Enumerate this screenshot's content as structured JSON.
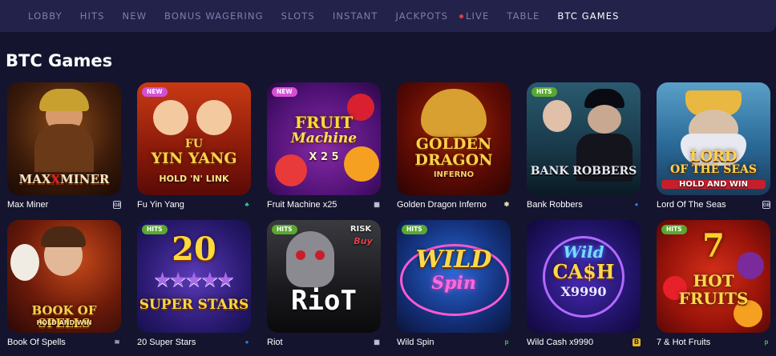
{
  "nav": {
    "items": [
      "LOBBY",
      "HITS",
      "NEW",
      "BONUS WAGERING",
      "SLOTS",
      "INSTANT",
      "JACKPOTS",
      "LIVE",
      "TABLE",
      "BTC GAMES"
    ],
    "active": "BTC GAMES"
  },
  "page_title": "BTC Games",
  "colors": {
    "background": "#14142f",
    "navbar": "#22224a",
    "nav_text": "#7d7eb0",
    "badge_new": "#d44fd6",
    "badge_hits": "#5aa832"
  },
  "games": [
    {
      "name": "Max Miner",
      "badge": "",
      "art_line1": "MAX",
      "art_x": "X",
      "art_line2": "MINER",
      "provider_icon": "GB"
    },
    {
      "name": "Fu Yin Yang",
      "badge": "NEW",
      "art_line1": "FU",
      "art_x": "YIN YANG",
      "art_line2": "HOLD 'N' LINK",
      "provider_icon": "green-leaf-icon"
    },
    {
      "name": "Fruit Machine x25",
      "badge": "NEW",
      "art_line1": "FRUIT",
      "art_x": "Machine",
      "art_line2": "X 2 5",
      "provider_icon": "qr-icon"
    },
    {
      "name": "Golden Dragon Inferno",
      "badge": "",
      "art_line1": "GOLDEN",
      "art_x": "DRAGON",
      "art_line2": "INFERNO",
      "provider_icon": "bee-icon"
    },
    {
      "name": "Bank Robbers",
      "badge": "HITS",
      "art_line1": "",
      "art_x": "",
      "art_line2": "BANK ROBBERS",
      "provider_icon": "blue-drop-icon"
    },
    {
      "name": "Lord Of The Seas",
      "badge": "",
      "art_line1": "LORD",
      "art_x": "OF THE SEAS",
      "art_line2": "HOLD AND WIN",
      "provider_icon": "GB"
    },
    {
      "name": "Book Of Spells",
      "badge": "",
      "art_line1": "BOOK OF SPELLS",
      "art_x": "",
      "art_line2": "HOLD AND WIN",
      "provider_icon": "bolt-icon"
    },
    {
      "name": "20 Super Stars",
      "badge": "HITS",
      "art_line1": "20",
      "art_x": "",
      "art_line2": "SUPER STARS",
      "provider_icon": "blue-drop-icon"
    },
    {
      "name": "Riot",
      "badge": "HITS",
      "art_line1": "Buy",
      "art_x": "RISK",
      "art_line2": "RioT",
      "provider_icon": "qr-icon"
    },
    {
      "name": "Wild Spin",
      "badge": "HITS",
      "art_line1": "WILD",
      "art_x": "Spin",
      "art_line2": "",
      "provider_icon": "p-icon"
    },
    {
      "name": "Wild Cash x9990",
      "badge": "",
      "art_line1": "Wild",
      "art_x": "CA$H",
      "art_line2": "X9990",
      "provider_icon": "b-icon"
    },
    {
      "name": "7 & Hot Fruits",
      "badge": "HITS",
      "art_line1": "7",
      "art_x": "HOT",
      "art_line2": "FRUITS",
      "provider_icon": "p-icon"
    }
  ]
}
